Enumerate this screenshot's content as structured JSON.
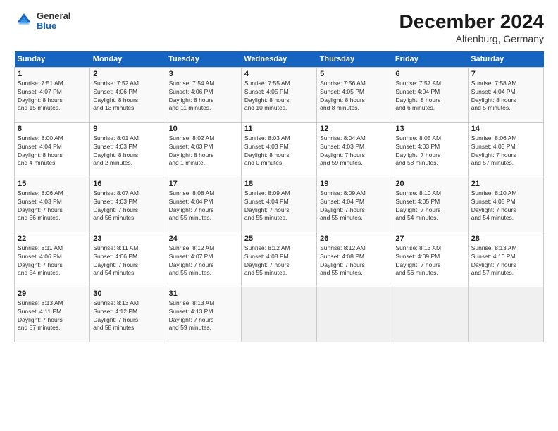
{
  "header": {
    "title": "December 2024",
    "subtitle": "Altenburg, Germany",
    "logo_line1": "General",
    "logo_line2": "Blue"
  },
  "days_of_week": [
    "Sunday",
    "Monday",
    "Tuesday",
    "Wednesday",
    "Thursday",
    "Friday",
    "Saturday"
  ],
  "weeks": [
    [
      {
        "num": "1",
        "rise": "7:51 AM",
        "set": "4:07 PM",
        "daylight": "8 hours and 15 minutes."
      },
      {
        "num": "2",
        "rise": "7:52 AM",
        "set": "4:06 PM",
        "daylight": "8 hours and 13 minutes."
      },
      {
        "num": "3",
        "rise": "7:54 AM",
        "set": "4:06 PM",
        "daylight": "8 hours and 11 minutes."
      },
      {
        "num": "4",
        "rise": "7:55 AM",
        "set": "4:05 PM",
        "daylight": "8 hours and 10 minutes."
      },
      {
        "num": "5",
        "rise": "7:56 AM",
        "set": "4:05 PM",
        "daylight": "8 hours and 8 minutes."
      },
      {
        "num": "6",
        "rise": "7:57 AM",
        "set": "4:04 PM",
        "daylight": "8 hours and 6 minutes."
      },
      {
        "num": "7",
        "rise": "7:58 AM",
        "set": "4:04 PM",
        "daylight": "8 hours and 5 minutes."
      }
    ],
    [
      {
        "num": "8",
        "rise": "8:00 AM",
        "set": "4:04 PM",
        "daylight": "8 hours and 4 minutes."
      },
      {
        "num": "9",
        "rise": "8:01 AM",
        "set": "4:03 PM",
        "daylight": "8 hours and 2 minutes."
      },
      {
        "num": "10",
        "rise": "8:02 AM",
        "set": "4:03 PM",
        "daylight": "8 hours and 1 minute."
      },
      {
        "num": "11",
        "rise": "8:03 AM",
        "set": "4:03 PM",
        "daylight": "8 hours and 0 minutes."
      },
      {
        "num": "12",
        "rise": "8:04 AM",
        "set": "4:03 PM",
        "daylight": "7 hours and 59 minutes."
      },
      {
        "num": "13",
        "rise": "8:05 AM",
        "set": "4:03 PM",
        "daylight": "7 hours and 58 minutes."
      },
      {
        "num": "14",
        "rise": "8:06 AM",
        "set": "4:03 PM",
        "daylight": "7 hours and 57 minutes."
      }
    ],
    [
      {
        "num": "15",
        "rise": "8:06 AM",
        "set": "4:03 PM",
        "daylight": "7 hours and 56 minutes."
      },
      {
        "num": "16",
        "rise": "8:07 AM",
        "set": "4:03 PM",
        "daylight": "7 hours and 56 minutes."
      },
      {
        "num": "17",
        "rise": "8:08 AM",
        "set": "4:04 PM",
        "daylight": "7 hours and 55 minutes."
      },
      {
        "num": "18",
        "rise": "8:09 AM",
        "set": "4:04 PM",
        "daylight": "7 hours and 55 minutes."
      },
      {
        "num": "19",
        "rise": "8:09 AM",
        "set": "4:04 PM",
        "daylight": "7 hours and 55 minutes."
      },
      {
        "num": "20",
        "rise": "8:10 AM",
        "set": "4:05 PM",
        "daylight": "7 hours and 54 minutes."
      },
      {
        "num": "21",
        "rise": "8:10 AM",
        "set": "4:05 PM",
        "daylight": "7 hours and 54 minutes."
      }
    ],
    [
      {
        "num": "22",
        "rise": "8:11 AM",
        "set": "4:06 PM",
        "daylight": "7 hours and 54 minutes."
      },
      {
        "num": "23",
        "rise": "8:11 AM",
        "set": "4:06 PM",
        "daylight": "7 hours and 54 minutes."
      },
      {
        "num": "24",
        "rise": "8:12 AM",
        "set": "4:07 PM",
        "daylight": "7 hours and 55 minutes."
      },
      {
        "num": "25",
        "rise": "8:12 AM",
        "set": "4:08 PM",
        "daylight": "7 hours and 55 minutes."
      },
      {
        "num": "26",
        "rise": "8:12 AM",
        "set": "4:08 PM",
        "daylight": "7 hours and 55 minutes."
      },
      {
        "num": "27",
        "rise": "8:13 AM",
        "set": "4:09 PM",
        "daylight": "7 hours and 56 minutes."
      },
      {
        "num": "28",
        "rise": "8:13 AM",
        "set": "4:10 PM",
        "daylight": "7 hours and 57 minutes."
      }
    ],
    [
      {
        "num": "29",
        "rise": "8:13 AM",
        "set": "4:11 PM",
        "daylight": "7 hours and 57 minutes."
      },
      {
        "num": "30",
        "rise": "8:13 AM",
        "set": "4:12 PM",
        "daylight": "7 hours and 58 minutes."
      },
      {
        "num": "31",
        "rise": "8:13 AM",
        "set": "4:13 PM",
        "daylight": "7 hours and 59 minutes."
      },
      null,
      null,
      null,
      null
    ]
  ]
}
